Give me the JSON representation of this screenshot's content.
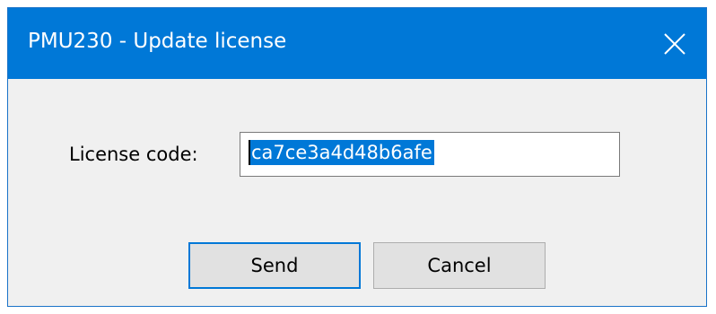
{
  "window": {
    "title": "PMU230 - Update license",
    "close_glyph": "✕"
  },
  "form": {
    "license_label": "License code:",
    "license_value": "ca7ce3a4d48b6afe"
  },
  "buttons": {
    "send_label": "Send",
    "cancel_label": "Cancel"
  },
  "icons": {
    "close": "close-icon"
  },
  "colors": {
    "titlebar": "#0078d7",
    "selection": "#0078d7",
    "dialog_bg": "#f0f0f0",
    "button_bg": "#e1e1e1"
  }
}
